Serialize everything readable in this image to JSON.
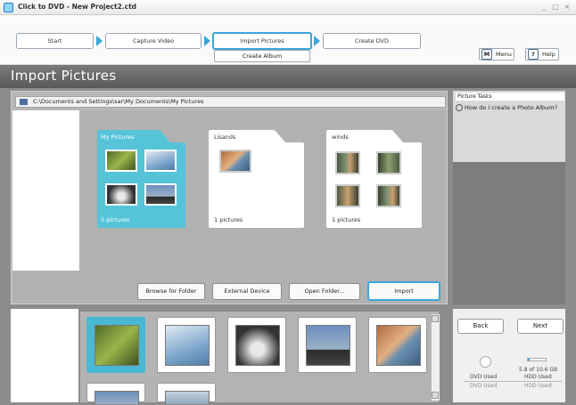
{
  "window": {
    "title": "Click to DVD - New Project2.ctd",
    "controls": [
      "_",
      "□",
      "×"
    ]
  },
  "steps": [
    {
      "label": "Start"
    },
    {
      "label": "Capture Video"
    },
    {
      "label": "Import Pictures"
    },
    {
      "label": "Create DVD"
    }
  ],
  "sub_step": "Create Album",
  "header_buttons": {
    "menu_key": "M",
    "menu_label": "Menu",
    "help_key": "?",
    "help_label": "Help"
  },
  "page_title": "Import Pictures",
  "path": "C:\\Documents and Settings\\sar\\My Documents\\My Pictures",
  "folders": [
    {
      "name": "My Pictures",
      "count": "5 pictures",
      "selected": true
    },
    {
      "name": "Lisands",
      "count": "1 pictures",
      "selected": false
    },
    {
      "name": "winds",
      "count": "1 pictures",
      "selected": false
    }
  ],
  "panel_buttons": {
    "browse": "Browse for Folder",
    "external": "External Device",
    "open": "Open Folder...",
    "import": "Import"
  },
  "tasks": {
    "heading": "Picture Tasks",
    "link": "How do I create a Photo Album?"
  },
  "nav": {
    "back": "Back",
    "next": "Next"
  },
  "capacity": {
    "dvd_label": "DVD Used",
    "hdd_value": "5.8 of 10.6 GB",
    "hdd_label": "HDD Used",
    "dvd_sub": "DVD Used",
    "hdd_sub": "HDD Used"
  },
  "colors": {
    "accent": "#3aa7d6",
    "selected_folder": "#55c4d8",
    "header": "#6a6a6a"
  }
}
